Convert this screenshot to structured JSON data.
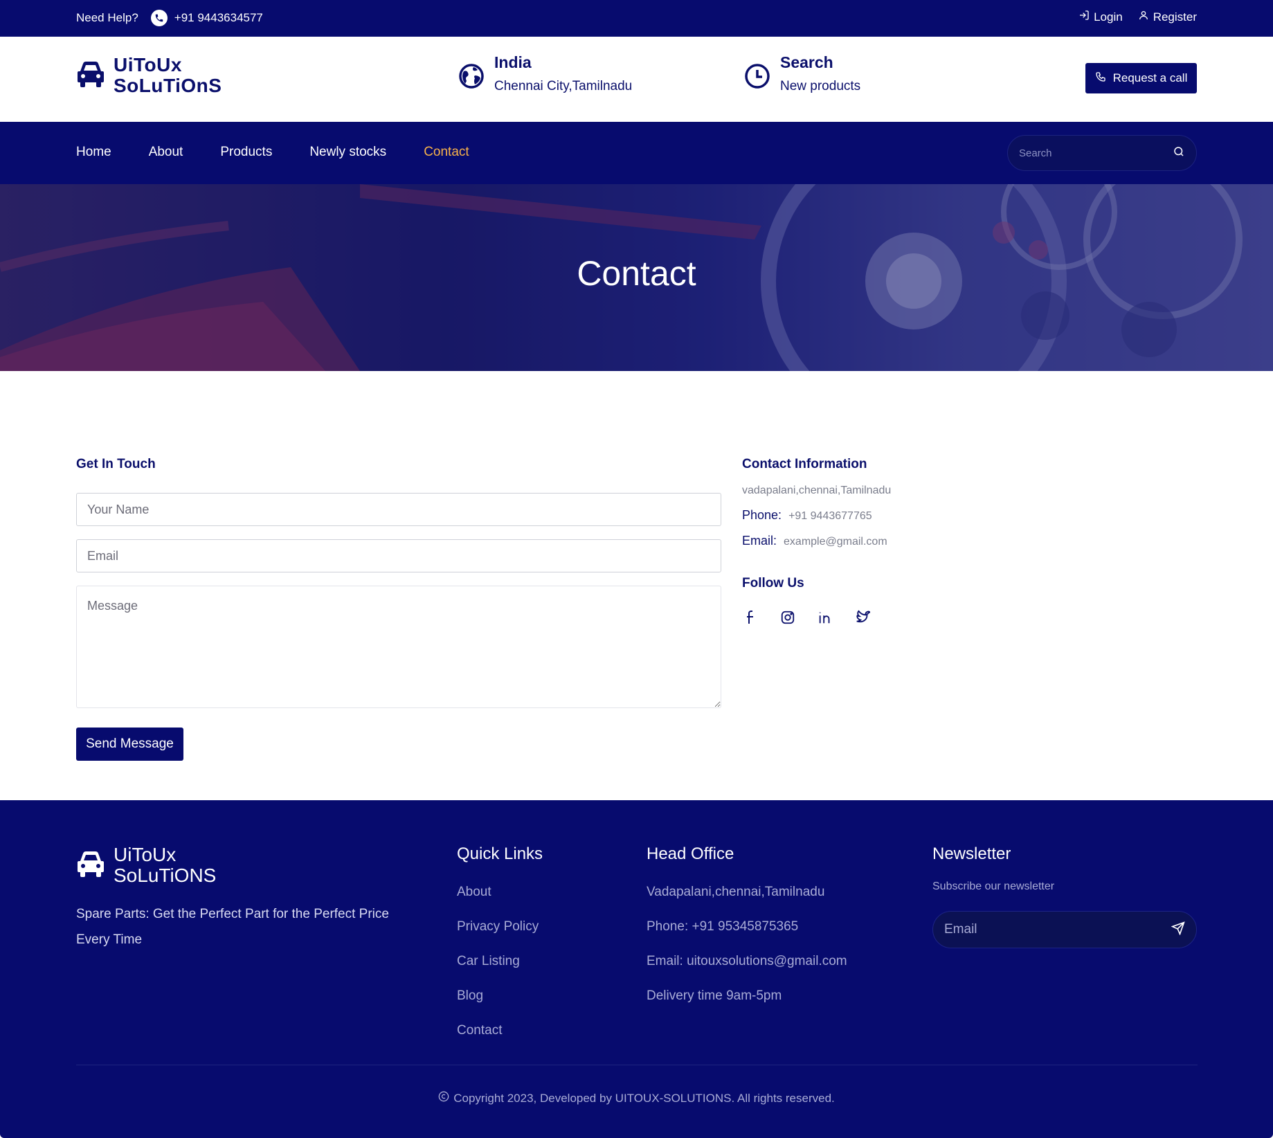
{
  "topbar": {
    "help": "Need Help?",
    "phone": "+91 9443634577",
    "login": "Login",
    "register": "Register"
  },
  "header": {
    "logo_line1": "UiToUx",
    "logo_line2": "SoLuTiOnS",
    "location_title": "India",
    "location_sub": "Chennai City,Tamilnadu",
    "search_title": "Search",
    "search_sub": "New products",
    "request_call": "Request a call"
  },
  "nav": {
    "items": [
      "Home",
      "About",
      "Products",
      "Newly stocks",
      "Contact"
    ],
    "active": "Contact",
    "search_placeholder": "Search"
  },
  "banner": {
    "title": "Contact"
  },
  "contact_form": {
    "title": "Get In Touch",
    "name_placeholder": "Your Name",
    "email_placeholder": "Email",
    "message_placeholder": "Message",
    "send_label": "Send Message"
  },
  "contact_info": {
    "title": "Contact Information",
    "address": "vadapalani,chennai,Tamilnadu",
    "phone_label": "Phone:",
    "phone_value": "+91 9443677765",
    "email_label": "Email:",
    "email_value": "example@gmail.com",
    "follow_title": "Follow Us",
    "socials": [
      "facebook-icon",
      "instagram-icon",
      "linkedin-icon",
      "twitter-icon"
    ]
  },
  "footer": {
    "logo_line1": "UiToUx",
    "logo_line2": "SoLuTiONS",
    "tagline": "Spare Parts: Get the Perfect Part for the Perfect Price Every Time",
    "quick_links_title": "Quick Links",
    "quick_links": [
      "About",
      "Privacy Policy",
      "Car Listing",
      "Blog",
      "Contact"
    ],
    "office_title": "Head Office",
    "office": [
      "Vadapalani,chennai,Tamilnadu",
      "Phone: +91 95345875365",
      "Email: uitouxsolutions@gmail.com",
      "Delivery time 9am-5pm"
    ],
    "newsletter_title": "Newsletter",
    "newsletter_sub": "Subscribe our newsletter",
    "newsletter_placeholder": "Email",
    "copyright": "Copyright 2023, Developed by UITOUX-SOLUTIONS. All rights reserved."
  },
  "colors": {
    "navy": "#070b6e",
    "accent": "#f7b24a"
  }
}
